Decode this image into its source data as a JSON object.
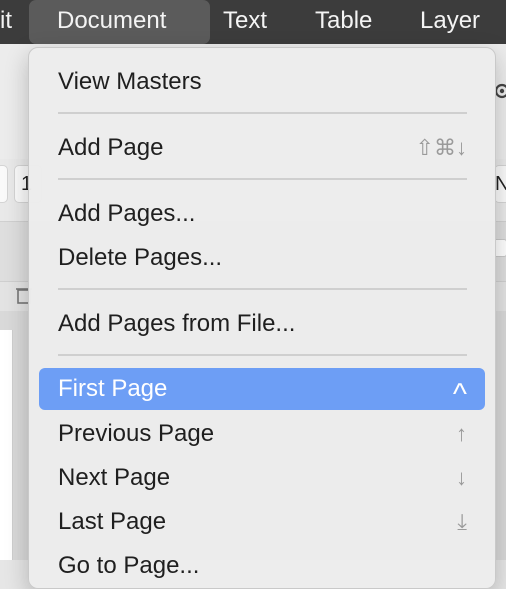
{
  "menubar": {
    "items": [
      {
        "label": "it"
      },
      {
        "label": "Document"
      },
      {
        "label": "Text"
      },
      {
        "label": "Table"
      },
      {
        "label": "Layer"
      }
    ]
  },
  "background": {
    "field_value": "1",
    "right_field_text": "N"
  },
  "document_menu": {
    "items": [
      {
        "label": "View Masters",
        "shortcut": ""
      },
      {
        "label": "Add Page",
        "shortcut": "⇧⌘↓"
      },
      {
        "label": "Add Pages...",
        "shortcut": ""
      },
      {
        "label": "Delete Pages...",
        "shortcut": ""
      },
      {
        "label": "Add Pages from File...",
        "shortcut": ""
      },
      {
        "label": "First Page",
        "shortcut": "^"
      },
      {
        "label": "Previous Page",
        "shortcut": "↑"
      },
      {
        "label": "Next Page",
        "shortcut": "↓"
      },
      {
        "label": "Last Page",
        "shortcut": "⤓"
      },
      {
        "label": "Go to Page...",
        "shortcut": ""
      }
    ],
    "highlighted_index": 5
  },
  "colors": {
    "menubar_bg": "#3c3c3c",
    "highlight": "#6d9ef5"
  }
}
